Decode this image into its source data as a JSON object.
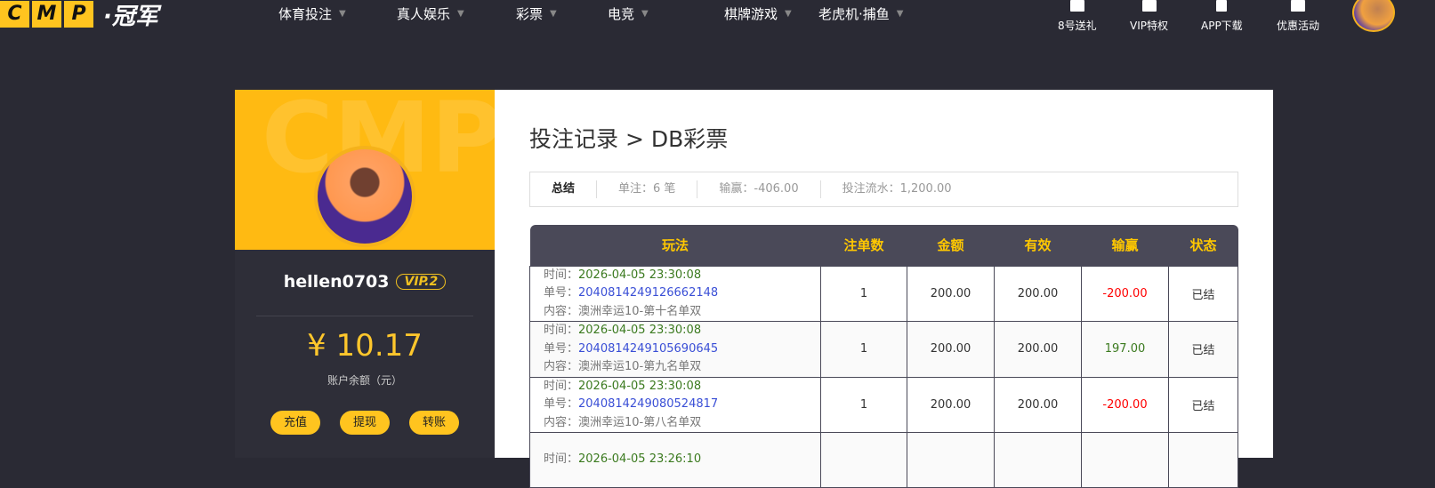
{
  "header": {
    "logo_letters": [
      "C",
      "M",
      "P"
    ],
    "logo_text": "·冠军",
    "nav": [
      "体育投注",
      "真人娱乐",
      "彩票",
      "电竞",
      "棋牌游戏",
      "老虎机·捕鱼"
    ],
    "quick": [
      "8号送礼",
      "VIP特权",
      "APP下载",
      "优惠活动"
    ]
  },
  "profile": {
    "watermark": "CMP",
    "username": "hellen0703",
    "vip": "VIP.2",
    "balance": "¥ 10.17",
    "balance_label": "账户余额（元）",
    "buttons": [
      "充值",
      "提现",
      "转账"
    ]
  },
  "page": {
    "title": "投注记录 > DB彩票",
    "summary": {
      "label": "总结",
      "count": "单注：6 笔",
      "winloss": "输赢：-406.00",
      "turnover": "投注流水：1,200.00"
    },
    "columns": [
      "玩法",
      "注单数",
      "金额",
      "有效",
      "输赢",
      "状态"
    ],
    "labels": {
      "time": "时间：",
      "order": "单号：",
      "content": "内容："
    },
    "rows": [
      {
        "time": "2026-04-05 23:30:08",
        "order": "2040814249126662148",
        "content": "澳洲幸运10-第十名单双",
        "count": "1",
        "amount": "200.00",
        "valid": "200.00",
        "winloss": "-200.00",
        "status": "已结"
      },
      {
        "time": "2026-04-05 23:30:08",
        "order": "2040814249105690645",
        "content": "澳洲幸运10-第九名单双",
        "count": "1",
        "amount": "200.00",
        "valid": "200.00",
        "winloss": "197.00",
        "status": "已结"
      },
      {
        "time": "2026-04-05 23:30:08",
        "order": "2040814249080524817",
        "content": "澳洲幸运10-第八名单双",
        "count": "1",
        "amount": "200.00",
        "valid": "200.00",
        "winloss": "-200.00",
        "status": "已结"
      },
      {
        "time": "2026-04-05 23:26:10"
      }
    ]
  }
}
